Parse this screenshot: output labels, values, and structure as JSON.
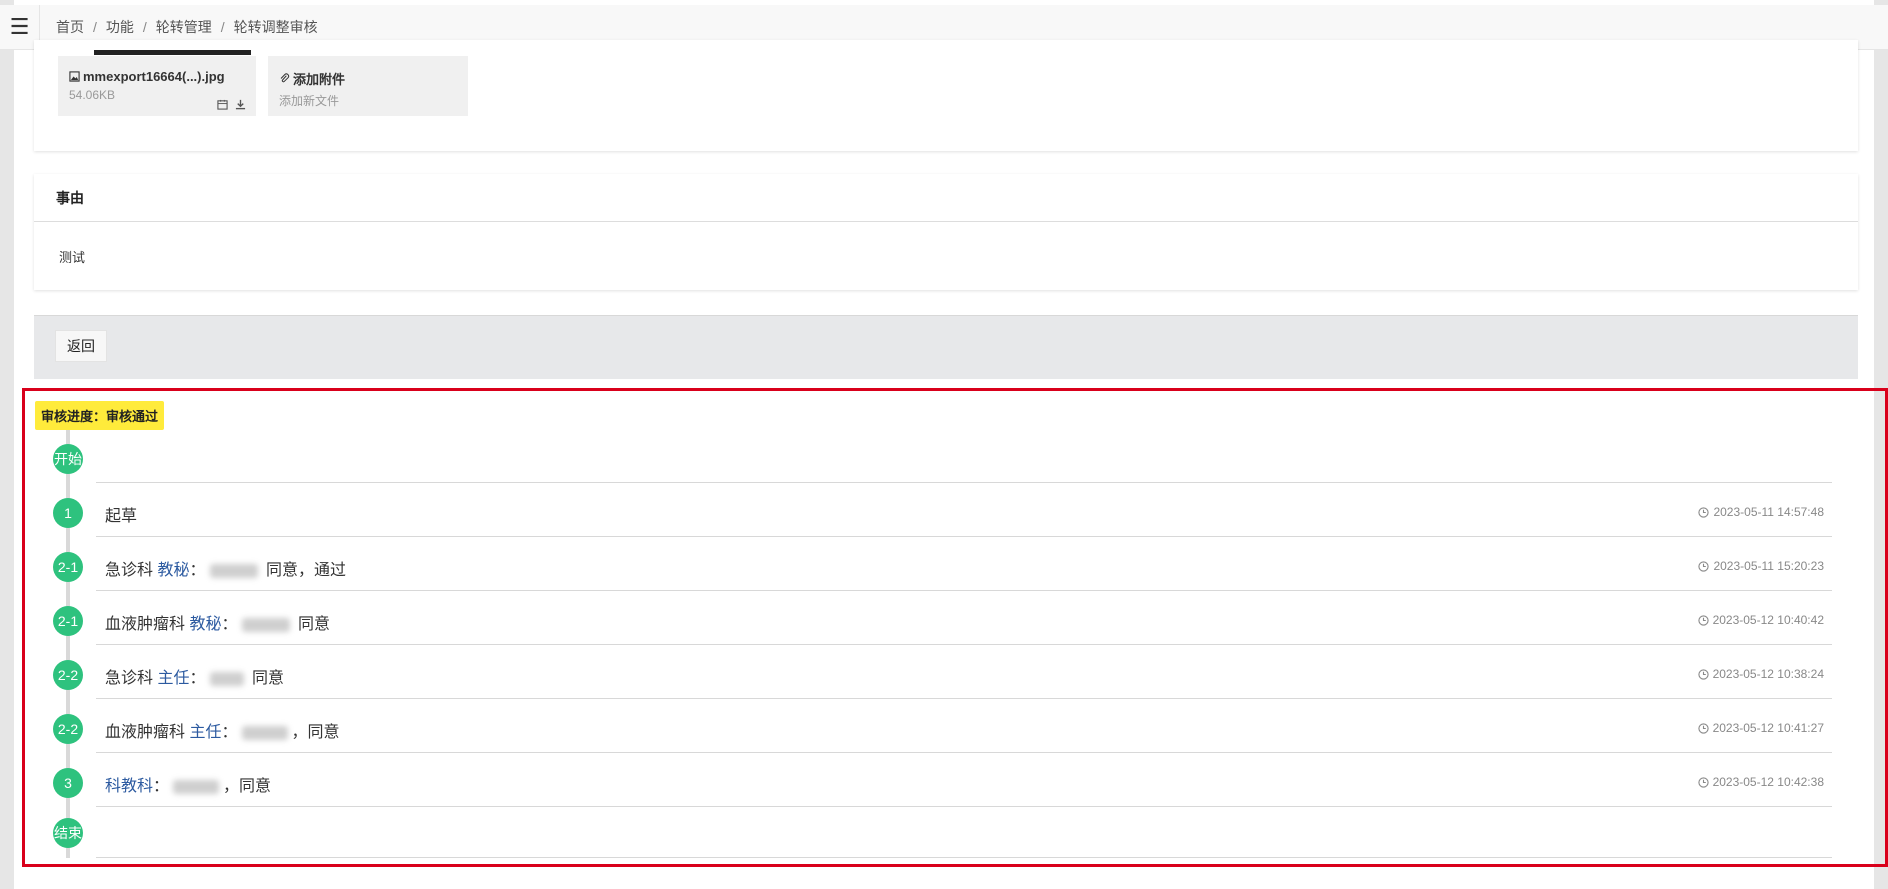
{
  "breadcrumb": [
    "首页",
    "功能",
    "轮转管理",
    "轮转调整审核"
  ],
  "attachments": [
    {
      "name": "mmexport16664(...).jpg",
      "size": "54.06KB"
    },
    {
      "name": "添加附件",
      "sub": "添加新文件"
    }
  ],
  "reason": {
    "title": "事由",
    "content": "测试"
  },
  "back_label": "返回",
  "status": "审核进度：审核通过",
  "timeline": [
    {
      "node": "开始"
    },
    {
      "node": "1",
      "dept": "起草",
      "time": "2023-05-11 14:57:48"
    },
    {
      "node": "2-1",
      "dept": "急诊科",
      "role": "教秘",
      "suffix": " 同意，通过",
      "time": "2023-05-11 15:20:23"
    },
    {
      "node": "2-1",
      "dept": "血液肿瘤科",
      "role": "教秘",
      "suffix": " 同意",
      "time": "2023-05-12 10:40:42"
    },
    {
      "node": "2-2",
      "dept": "急诊科",
      "role": "主任",
      "suffix": " 同意",
      "time": "2023-05-12 10:38:24"
    },
    {
      "node": "2-2",
      "dept": "血液肿瘤科",
      "role": "主任",
      "suffix": "，同意",
      "time": "2023-05-12 10:41:27"
    },
    {
      "node": "3",
      "role": "科教科",
      "suffix": "，同意",
      "time": "2023-05-12 10:42:38"
    },
    {
      "node": "结束"
    }
  ],
  "colors": {
    "node": "#2ec27e",
    "badge": "#ffeb3b",
    "highlight": "#d9001b",
    "role": "#2c5aa0"
  }
}
